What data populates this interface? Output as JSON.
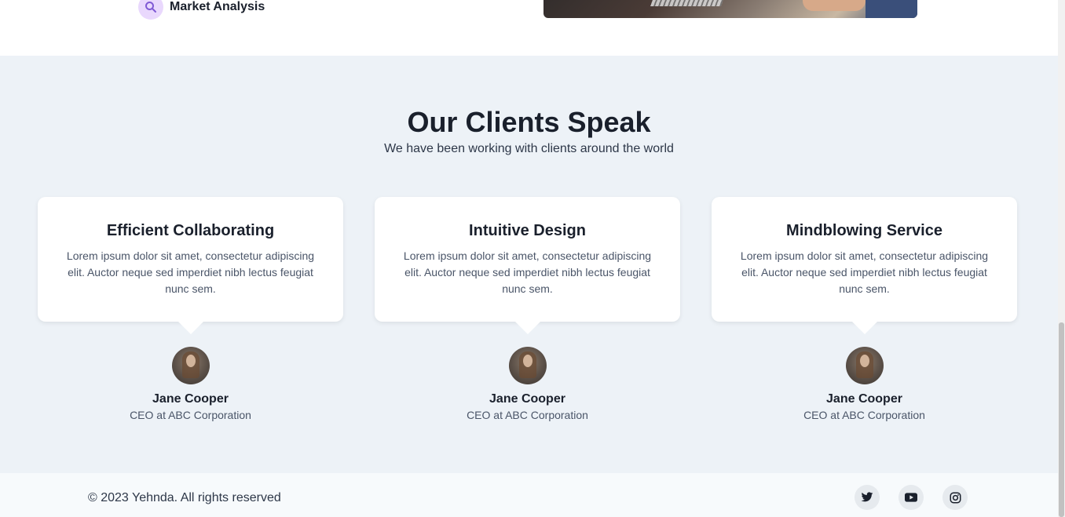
{
  "feature": {
    "label": "Market Analysis",
    "icon": "search-icon"
  },
  "testimonials": {
    "title": "Our Clients Speak",
    "subtitle": "We have been working with clients around the world",
    "cards": [
      {
        "title": "Efficient Collaborating",
        "text": "Lorem ipsum dolor sit amet, consectetur adipiscing elit. Auctor neque sed imperdiet nibh lectus feugiat nunc sem.",
        "name": "Jane Cooper",
        "role": "CEO at ABC Corporation"
      },
      {
        "title": "Intuitive Design",
        "text": "Lorem ipsum dolor sit amet, consectetur adipiscing elit. Auctor neque sed imperdiet nibh lectus feugiat nunc sem.",
        "name": "Jane Cooper",
        "role": "CEO at ABC Corporation"
      },
      {
        "title": "Mindblowing Service",
        "text": "Lorem ipsum dolor sit amet, consectetur adipiscing elit. Auctor neque sed imperdiet nibh lectus feugiat nunc sem.",
        "name": "Jane Cooper",
        "role": "CEO at ABC Corporation"
      }
    ]
  },
  "footer": {
    "copyright": "© 2023 Yehnda. All rights reserved",
    "social": [
      "twitter-icon",
      "youtube-icon",
      "instagram-icon"
    ]
  },
  "colors": {
    "section_bg": "#edf2f7",
    "footer_bg": "#f7fafc",
    "icon_accent": "#805ad5",
    "icon_bg": "#e9d8fd"
  }
}
